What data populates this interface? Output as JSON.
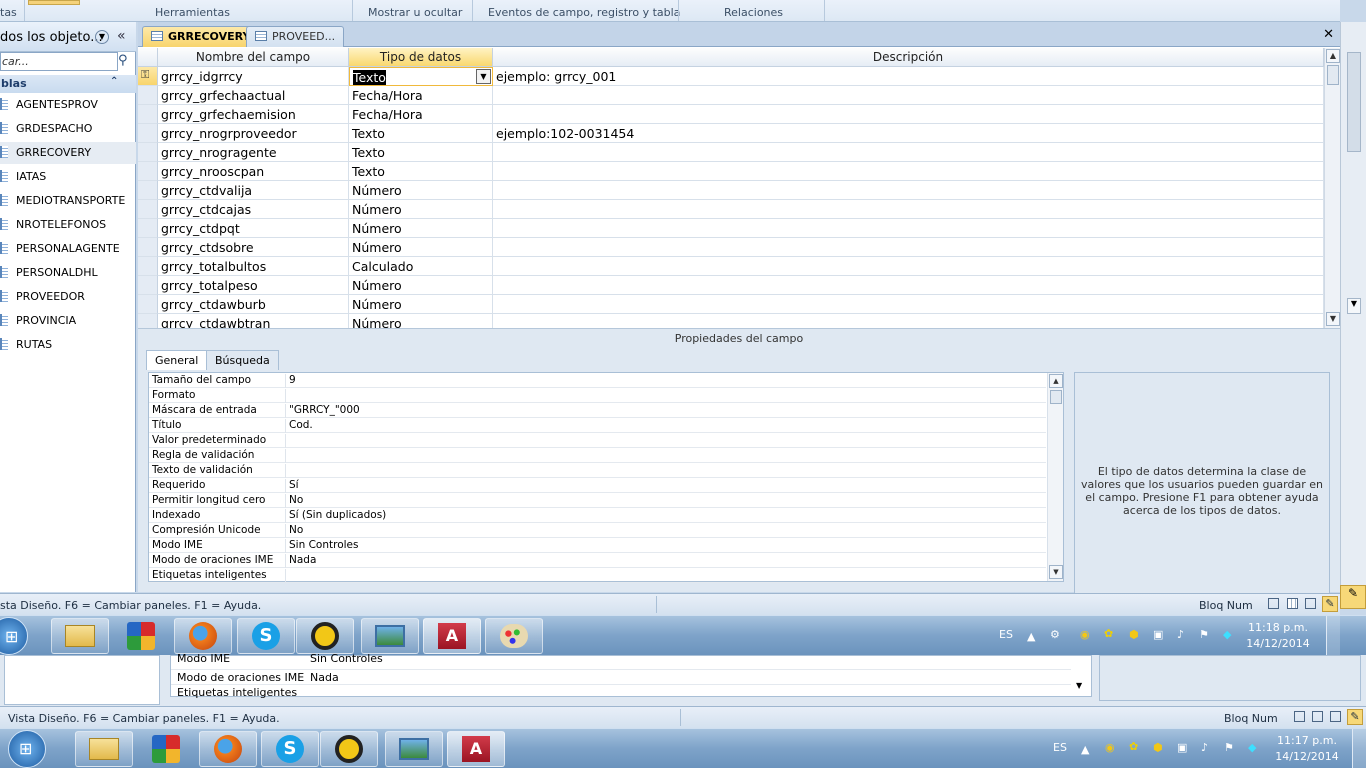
{
  "ribbon": {
    "groups": [
      "tas",
      "Herramientas",
      "Mostrar u ocultar",
      "Eventos de campo, registro y tabla",
      "Relaciones"
    ]
  },
  "nav": {
    "header": "dos los objeto...",
    "search_placeholder": "car...",
    "category": "blas",
    "items": [
      "AGENTESPROV",
      "GRDESPACHO",
      "GRRECOVERY",
      "IATAS",
      "MEDIOTRANSPORTE",
      "NROTELEFONOS",
      "PERSONALAGENTE",
      "PERSONALDHL",
      "PROVEEDOR",
      "PROVINCIA",
      "RUTAS"
    ],
    "selected": "GRRECOVERY"
  },
  "tabs": [
    {
      "label": "GRRECOVERY",
      "active": true
    },
    {
      "label": "PROVEED...",
      "active": false
    }
  ],
  "grid": {
    "headers": [
      "Nombre del campo",
      "Tipo de datos",
      "Descripción"
    ],
    "rows": [
      {
        "name": "grrcy_idgrrcy",
        "type": "Texto",
        "desc": "ejemplo: grrcy_001"
      },
      {
        "name": "grrcy_grfechaactual",
        "type": "Fecha/Hora",
        "desc": ""
      },
      {
        "name": "grrcy_grfechaemision",
        "type": "Fecha/Hora",
        "desc": ""
      },
      {
        "name": "grrcy_nrogrproveedor",
        "type": "Texto",
        "desc": "ejemplo:102-0031454"
      },
      {
        "name": "grrcy_nrogragente",
        "type": "Texto",
        "desc": ""
      },
      {
        "name": "grrcy_nrooscpan",
        "type": "Texto",
        "desc": ""
      },
      {
        "name": "grrcy_ctdvalija",
        "type": "Número",
        "desc": ""
      },
      {
        "name": "grrcy_ctdcajas",
        "type": "Número",
        "desc": ""
      },
      {
        "name": "grrcy_ctdpqt",
        "type": "Número",
        "desc": ""
      },
      {
        "name": "grrcy_ctdsobre",
        "type": "Número",
        "desc": ""
      },
      {
        "name": "grrcy_totalbultos",
        "type": "Calculado",
        "desc": ""
      },
      {
        "name": "grrcy_totalpeso",
        "type": "Número",
        "desc": ""
      },
      {
        "name": "grrcy_ctdawburb",
        "type": "Número",
        "desc": ""
      },
      {
        "name": "grrcy_ctdawbtran",
        "type": "Número",
        "desc": ""
      }
    ]
  },
  "props": {
    "title": "Propiedades del campo",
    "tabs": [
      "General",
      "Búsqueda"
    ],
    "rows": [
      {
        "label": "Tamaño del campo",
        "value": "9"
      },
      {
        "label": "Formato",
        "value": ""
      },
      {
        "label": "Máscara de entrada",
        "value": "\"GRRCY_\"000"
      },
      {
        "label": "Título",
        "value": "Cod."
      },
      {
        "label": "Valor predeterminado",
        "value": ""
      },
      {
        "label": "Regla de validación",
        "value": ""
      },
      {
        "label": "Texto de validación",
        "value": ""
      },
      {
        "label": "Requerido",
        "value": "Sí"
      },
      {
        "label": "Permitir longitud cero",
        "value": "No"
      },
      {
        "label": "Indexado",
        "value": "Sí (Sin duplicados)"
      },
      {
        "label": "Compresión Unicode",
        "value": "No"
      },
      {
        "label": "Modo IME",
        "value": "Sin Controles"
      },
      {
        "label": "Modo de oraciones IME",
        "value": "Nada"
      },
      {
        "label": "Etiquetas inteligentes",
        "value": ""
      }
    ],
    "help": "El tipo de datos determina la clase de valores que los usuarios pueden guardar en el campo. Presione F1 para obtener ayuda acerca de los tipos de datos."
  },
  "status": {
    "text": "sta Diseño.  F6 = Cambiar paneles.  F1 = Ayuda.",
    "bloq": "Bloq Num"
  },
  "taskbar": {
    "lang": "ES",
    "time": "11:18 p.m.",
    "date": "14/12/2014"
  },
  "ghost": {
    "rows": [
      {
        "label": "Modo IME",
        "value": "Sin Controles"
      },
      {
        "label": "Modo de oraciones IME",
        "value": "Nada"
      },
      {
        "label": "Etiquetas inteligentes",
        "value": ""
      }
    ],
    "status": "Vista Diseño.  F6 = Cambiar paneles.  F1 = Ayuda.",
    "bloq": "Bloq Num",
    "lang": "ES",
    "time": "11:17 p.m.",
    "date": "14/12/2014"
  },
  "colors": {
    "accent_tab": "#f8d46c",
    "selection_black": "#000000"
  }
}
